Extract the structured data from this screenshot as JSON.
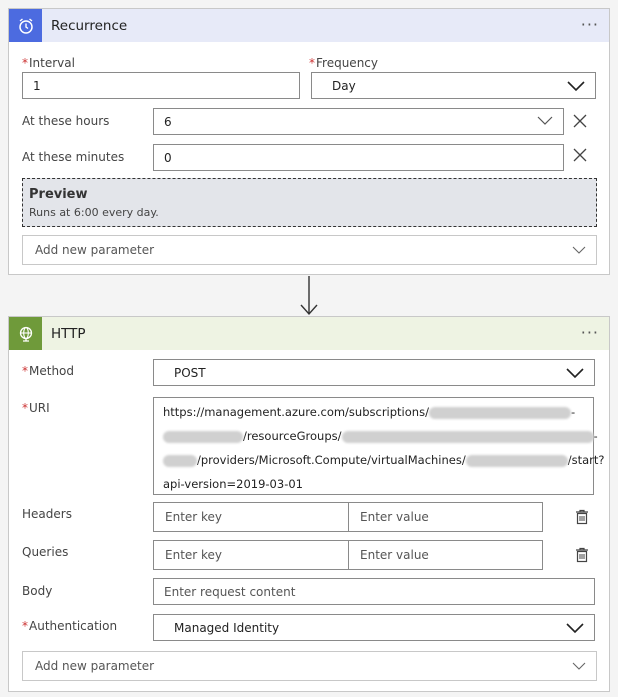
{
  "recurrence": {
    "title": "Recurrence",
    "more": "···",
    "interval_label": "Interval",
    "interval_value": "1",
    "frequency_label": "Frequency",
    "frequency_value": "Day",
    "hours_label": "At these hours",
    "hours_value": "6",
    "minutes_label": "At these minutes",
    "minutes_value": "0",
    "preview_title": "Preview",
    "preview_text": "Runs at 6:00 every day.",
    "add_param": "Add new parameter"
  },
  "http": {
    "title": "HTTP",
    "more": "···",
    "method_label": "Method",
    "method_value": "POST",
    "uri_label": "URI",
    "uri_line1": "https://management.azure.com/subscriptions/",
    "uri_line2": "/resourceGroups/",
    "uri_line3": "/providers/Microsoft.Compute/virtualMachines/",
    "uri_line3_end": "/start?",
    "uri_line4": "api-version=2019-03-01",
    "headers_label": "Headers",
    "queries_label": "Queries",
    "key_placeholder": "Enter key",
    "value_placeholder": "Enter value",
    "body_label": "Body",
    "body_placeholder": "Enter request content",
    "auth_label": "Authentication",
    "auth_value": "Managed Identity",
    "add_param": "Add new parameter"
  },
  "colors": {
    "recurrence_header": "#e7eaf8",
    "recurrence_icon": "#4c6be0",
    "http_header": "#eef3e3",
    "http_icon": "#6f9a3a"
  }
}
